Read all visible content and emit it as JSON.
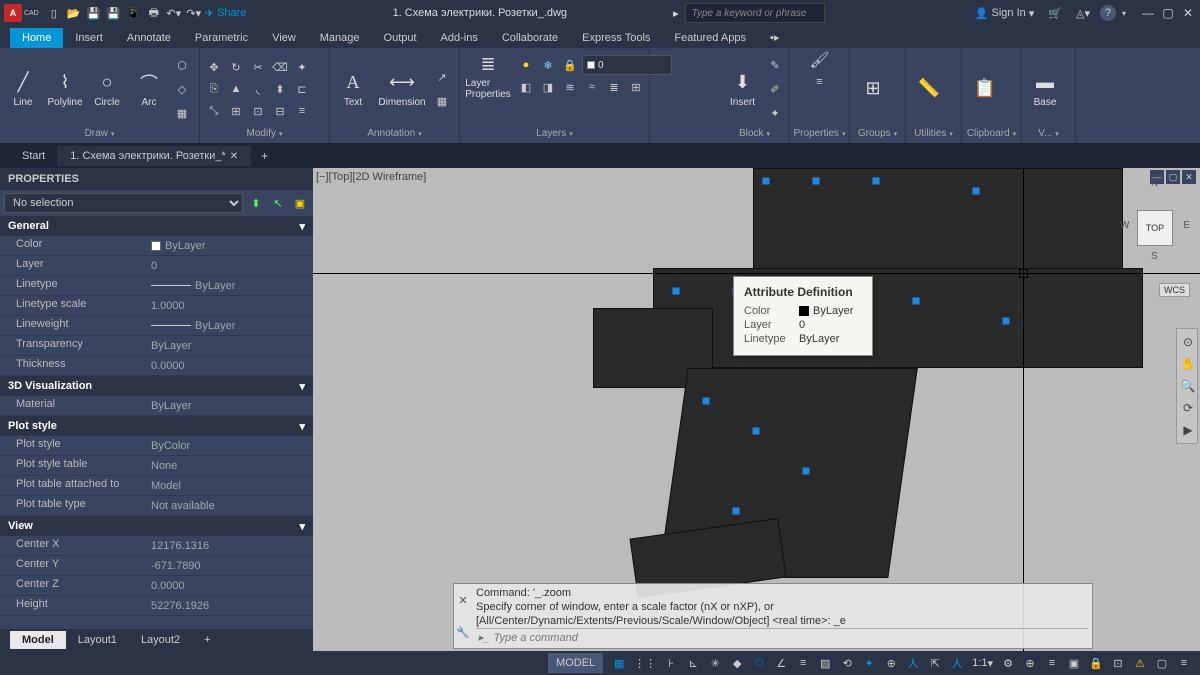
{
  "title": "1. Схема электрики. Розетки_.dwg",
  "search_placeholder": "Type a keyword or phrase",
  "signin": "Sign In",
  "share": "Share",
  "ribbon_tabs": [
    "Home",
    "Insert",
    "Annotate",
    "Parametric",
    "View",
    "Manage",
    "Output",
    "Add-ins",
    "Collaborate",
    "Express Tools",
    "Featured Apps"
  ],
  "draw": {
    "label": "Draw",
    "line": "Line",
    "polyline": "Polyline",
    "circle": "Circle",
    "arc": "Arc"
  },
  "modify": {
    "label": "Modify"
  },
  "annotation": {
    "label": "Annotation",
    "text": "Text",
    "dimension": "Dimension"
  },
  "layers": {
    "label": "Layers",
    "layer_props": "Layer\nProperties",
    "current": "0"
  },
  "block": {
    "label": "Block",
    "insert": "Insert"
  },
  "properties": {
    "label": "Properties"
  },
  "groups": {
    "label": "Groups"
  },
  "utilities": {
    "label": "Utilities"
  },
  "clipboard": {
    "label": "Clipboard"
  },
  "view_panel": {
    "label": "V...",
    "base": "Base"
  },
  "file_tabs": {
    "start": "Start",
    "doc": "1. Схема электрики. Розетки_*"
  },
  "props": {
    "title": "PROPERTIES",
    "selection": "No selection",
    "sections": {
      "general": "General",
      "viz": "3D Visualization",
      "plot": "Plot style",
      "view": "View"
    },
    "rows": {
      "color": {
        "n": "Color",
        "v": "ByLayer"
      },
      "layer": {
        "n": "Layer",
        "v": "0"
      },
      "linetype": {
        "n": "Linetype",
        "v": "ByLayer"
      },
      "ltscale": {
        "n": "Linetype scale",
        "v": "1.0000"
      },
      "lineweight": {
        "n": "Lineweight",
        "v": "ByLayer"
      },
      "transparency": {
        "n": "Transparency",
        "v": "ByLayer"
      },
      "thickness": {
        "n": "Thickness",
        "v": "0.0000"
      },
      "material": {
        "n": "Material",
        "v": "ByLayer"
      },
      "plotstyle": {
        "n": "Plot style",
        "v": "ByColor"
      },
      "plottable": {
        "n": "Plot style table",
        "v": "None"
      },
      "plotattached": {
        "n": "Plot table attached to",
        "v": "Model"
      },
      "plottype": {
        "n": "Plot table type",
        "v": "Not available"
      },
      "cx": {
        "n": "Center X",
        "v": "12176.1316"
      },
      "cy": {
        "n": "Center Y",
        "v": "-671.7890"
      },
      "cz": {
        "n": "Center Z",
        "v": "0.0000"
      },
      "height": {
        "n": "Height",
        "v": "52276.1926"
      }
    }
  },
  "viewport_label": "[−][Top][2D Wireframe]",
  "viewcube": {
    "top": "TOP",
    "n": "N",
    "s": "S",
    "e": "E",
    "w": "W",
    "wcs": "WCS"
  },
  "tooltip": {
    "title": "Attribute Definition",
    "color": {
      "n": "Color",
      "v": "ByLayer"
    },
    "layer": {
      "n": "Layer",
      "v": "0"
    },
    "linetype": {
      "n": "Linetype",
      "v": "ByLayer"
    }
  },
  "cmd": {
    "l1": "Command: '_.zoom",
    "l2": "Specify corner of window, enter a scale factor (nX or nXP), or",
    "l3": "[All/Center/Dynamic/Extents/Previous/Scale/Window/Object] <real time>: _e",
    "prompt": "Type a command"
  },
  "layout_tabs": {
    "model": "Model",
    "l1": "Layout1",
    "l2": "Layout2"
  },
  "status": {
    "model": "MODEL",
    "scale": "1:1"
  }
}
